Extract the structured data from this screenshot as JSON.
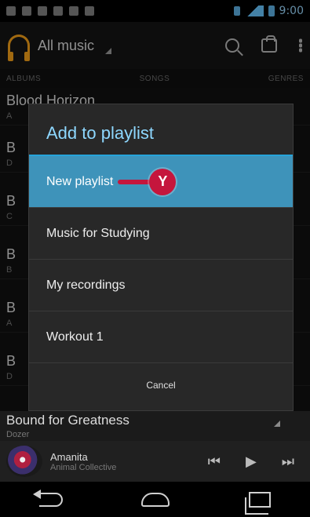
{
  "status_bar": {
    "time": "9:00",
    "icons": [
      "message-icon",
      "gallery-icon",
      "sd-card-icon",
      "shop-bag-icon",
      "shop-bag-icon",
      "gamepad-icon"
    ],
    "system_icons": [
      "bluetooth-icon",
      "wifi-icon",
      "signal-icon",
      "battery-icon"
    ]
  },
  "action_bar": {
    "title": "All music",
    "icons": [
      "headphones-icon",
      "search-icon",
      "shop-icon",
      "overflow-menu-icon"
    ],
    "accent_color": "#f6a21a"
  },
  "tabs": [
    "ALBUMS",
    "SONGS",
    "GENRES"
  ],
  "background_list": {
    "rows": [
      {
        "title": "Blood Horizon",
        "sub": "A"
      },
      {
        "title": "B",
        "sub": "D"
      },
      {
        "title": "B",
        "sub": "C"
      },
      {
        "title": "B",
        "sub": "B"
      },
      {
        "title": "B",
        "sub": "A"
      },
      {
        "title": "B",
        "sub": "D"
      }
    ],
    "bottom_row": {
      "title": "Bound for Greatness",
      "sub": "Dozer"
    }
  },
  "dialog": {
    "title": "Add to playlist",
    "items": [
      {
        "label": "New playlist",
        "selected": true
      },
      {
        "label": "Music for Studying",
        "selected": false
      },
      {
        "label": "My recordings",
        "selected": false
      },
      {
        "label": "Workout 1",
        "selected": false
      }
    ],
    "cancel": "Cancel",
    "callout_label": "Y",
    "callout_color": "#c5163d",
    "selected_color": "#3e93ba"
  },
  "now_playing": {
    "title": "Amanita",
    "artist": "Animal Collective",
    "controls": [
      "previous-icon",
      "play-icon",
      "next-icon"
    ]
  },
  "nav_bar": {
    "icons": [
      "back-icon",
      "home-icon",
      "recent-apps-icon"
    ]
  }
}
